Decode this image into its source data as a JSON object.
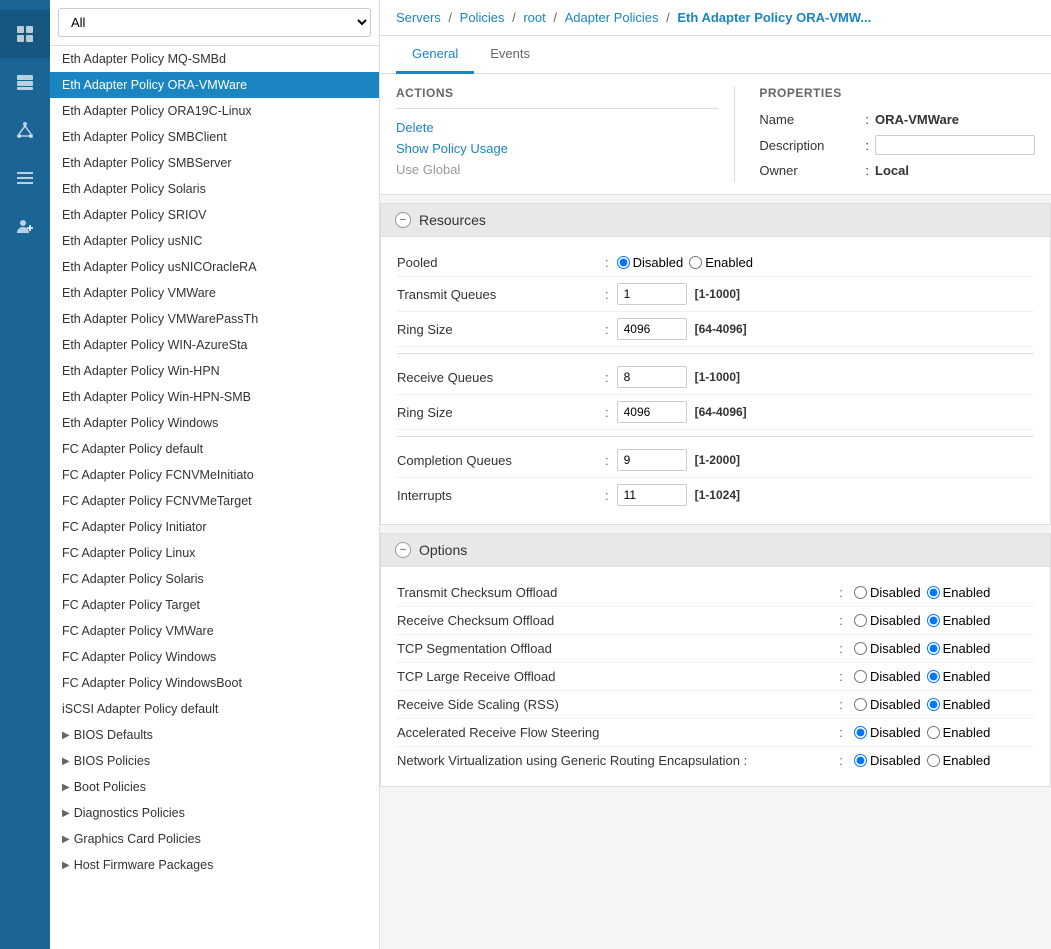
{
  "nav": {
    "icons": [
      "grid",
      "server",
      "network",
      "list-alt",
      "user-plus"
    ]
  },
  "sidebar": {
    "filter_value": "All",
    "filter_options": [
      "All"
    ],
    "items": [
      {
        "label": "Eth Adapter Policy MQ-SMBd",
        "active": false
      },
      {
        "label": "Eth Adapter Policy ORA-VMWare",
        "active": true
      },
      {
        "label": "Eth Adapter Policy ORA19C-Linux",
        "active": false
      },
      {
        "label": "Eth Adapter Policy SMBClient",
        "active": false
      },
      {
        "label": "Eth Adapter Policy SMBServer",
        "active": false
      },
      {
        "label": "Eth Adapter Policy Solaris",
        "active": false
      },
      {
        "label": "Eth Adapter Policy SRIOV",
        "active": false
      },
      {
        "label": "Eth Adapter Policy usNIC",
        "active": false
      },
      {
        "label": "Eth Adapter Policy usNICOracleRA",
        "active": false
      },
      {
        "label": "Eth Adapter Policy VMWare",
        "active": false
      },
      {
        "label": "Eth Adapter Policy VMWarePassTh",
        "active": false
      },
      {
        "label": "Eth Adapter Policy WIN-AzureSta",
        "active": false
      },
      {
        "label": "Eth Adapter Policy Win-HPN",
        "active": false
      },
      {
        "label": "Eth Adapter Policy Win-HPN-SMB",
        "active": false
      },
      {
        "label": "Eth Adapter Policy Windows",
        "active": false
      },
      {
        "label": "FC Adapter Policy default",
        "active": false
      },
      {
        "label": "FC Adapter Policy FCNVMeInitiato",
        "active": false
      },
      {
        "label": "FC Adapter Policy FCNVMeTarget",
        "active": false
      },
      {
        "label": "FC Adapter Policy Initiator",
        "active": false
      },
      {
        "label": "FC Adapter Policy Linux",
        "active": false
      },
      {
        "label": "FC Adapter Policy Solaris",
        "active": false
      },
      {
        "label": "FC Adapter Policy Target",
        "active": false
      },
      {
        "label": "FC Adapter Policy VMWare",
        "active": false
      },
      {
        "label": "FC Adapter Policy Windows",
        "active": false
      },
      {
        "label": "FC Adapter Policy WindowsBoot",
        "active": false
      },
      {
        "label": "iSCSI Adapter Policy default",
        "active": false
      }
    ],
    "groups": [
      {
        "label": "BIOS Defaults"
      },
      {
        "label": "BIOS Policies"
      },
      {
        "label": "Boot Policies"
      },
      {
        "label": "Diagnostics Policies"
      },
      {
        "label": "Graphics Card Policies"
      },
      {
        "label": "Host Firmware Packages"
      }
    ]
  },
  "breadcrumb": {
    "parts": [
      "Servers",
      "Policies",
      "root",
      "Adapter Policies"
    ],
    "current": "Eth Adapter Policy ORA-VMW..."
  },
  "tabs": [
    {
      "label": "General",
      "active": true
    },
    {
      "label": "Events",
      "active": false
    }
  ],
  "actions": {
    "title": "Actions",
    "items": [
      {
        "label": "Delete",
        "disabled": false
      },
      {
        "label": "Show Policy Usage",
        "disabled": false
      },
      {
        "label": "Use Global",
        "disabled": true
      }
    ]
  },
  "properties": {
    "title": "Properties",
    "name_label": "Name",
    "name_value": "ORA-VMWare",
    "desc_label": "Description",
    "desc_value": "",
    "owner_label": "Owner",
    "owner_value": "Local"
  },
  "resources": {
    "section_title": "Resources",
    "pooled_label": "Pooled",
    "pooled_disabled": true,
    "pooled_enabled": false,
    "transmit_queues_label": "Transmit Queues",
    "transmit_queues_value": "1",
    "transmit_queues_range": "[1-1000]",
    "ring_size_tx_label": "Ring Size",
    "ring_size_tx_value": "4096",
    "ring_size_tx_range": "[64-4096]",
    "receive_queues_label": "Receive Queues",
    "receive_queues_value": "8",
    "receive_queues_range": "[1-1000]",
    "ring_size_rx_label": "Ring Size",
    "ring_size_rx_value": "4096",
    "ring_size_rx_range": "[64-4096]",
    "completion_queues_label": "Completion Queues",
    "completion_queues_value": "9",
    "completion_queues_range": "[1-2000]",
    "interrupts_label": "Interrupts",
    "interrupts_value": "11",
    "interrupts_range": "[1-1024]"
  },
  "options": {
    "section_title": "Options",
    "rows": [
      {
        "label": "Transmit Checksum Offload",
        "disabled": false,
        "enabled": true
      },
      {
        "label": "Receive Checksum Offload",
        "disabled": false,
        "enabled": true
      },
      {
        "label": "TCP Segmentation Offload",
        "disabled": false,
        "enabled": true
      },
      {
        "label": "TCP Large Receive Offload",
        "disabled": false,
        "enabled": true
      },
      {
        "label": "Receive Side Scaling (RSS)",
        "disabled": false,
        "enabled": true
      },
      {
        "label": "Accelerated Receive Flow Steering",
        "disabled": true,
        "enabled": false
      },
      {
        "label": "Network Virtualization using Generic Routing Encapsulation :",
        "disabled": true,
        "enabled": false
      }
    ],
    "disabled_label": "Disabled",
    "enabled_label": "Enabled"
  }
}
